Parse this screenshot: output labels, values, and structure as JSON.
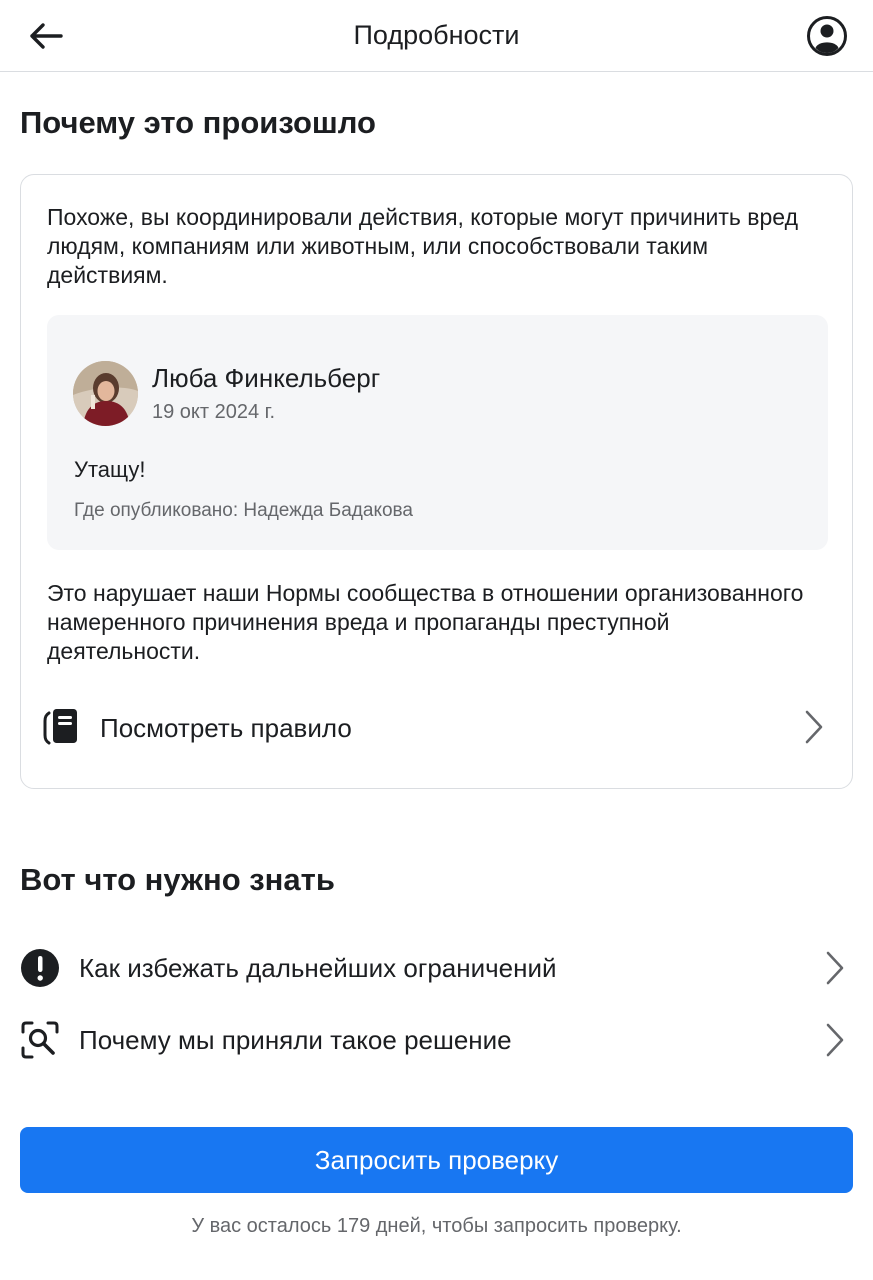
{
  "header": {
    "title": "Подробности",
    "back_icon": "arrow-left-icon",
    "profile_icon": "user-circle-icon"
  },
  "why": {
    "title": "Почему это произошло",
    "intro": "Похоже, вы координировали действия, которые могут причинить вред людям, компаниям или животным, или способствовали таким действиям.",
    "post": {
      "author": "Люба Финкельберг",
      "date": "19 окт 2024 г.",
      "text": "Утащу!",
      "where": "Где опубликовано: Надежда Бадакова"
    },
    "violation": "Это нарушает наши Нормы сообщества в отношении организованного намеренного причинения вреда и пропаганды преступной деятельности.",
    "rule_link": "Посмотреть правило"
  },
  "know": {
    "title": "Вот что нужно знать",
    "items": [
      {
        "label": "Как избежать дальнейших ограничений",
        "icon": "exclamation-circle-icon"
      },
      {
        "label": "Почему мы приняли такое решение",
        "icon": "magnifier-scan-icon"
      }
    ]
  },
  "action": {
    "button": "Запросить проверку",
    "note": "У вас осталось 179 дней, чтобы запросить проверку."
  },
  "colors": {
    "primary": "#1877f2",
    "text": "#1c1e21",
    "secondary_text": "#65676b",
    "border": "#dadde1",
    "post_bg": "#f5f6f8"
  }
}
